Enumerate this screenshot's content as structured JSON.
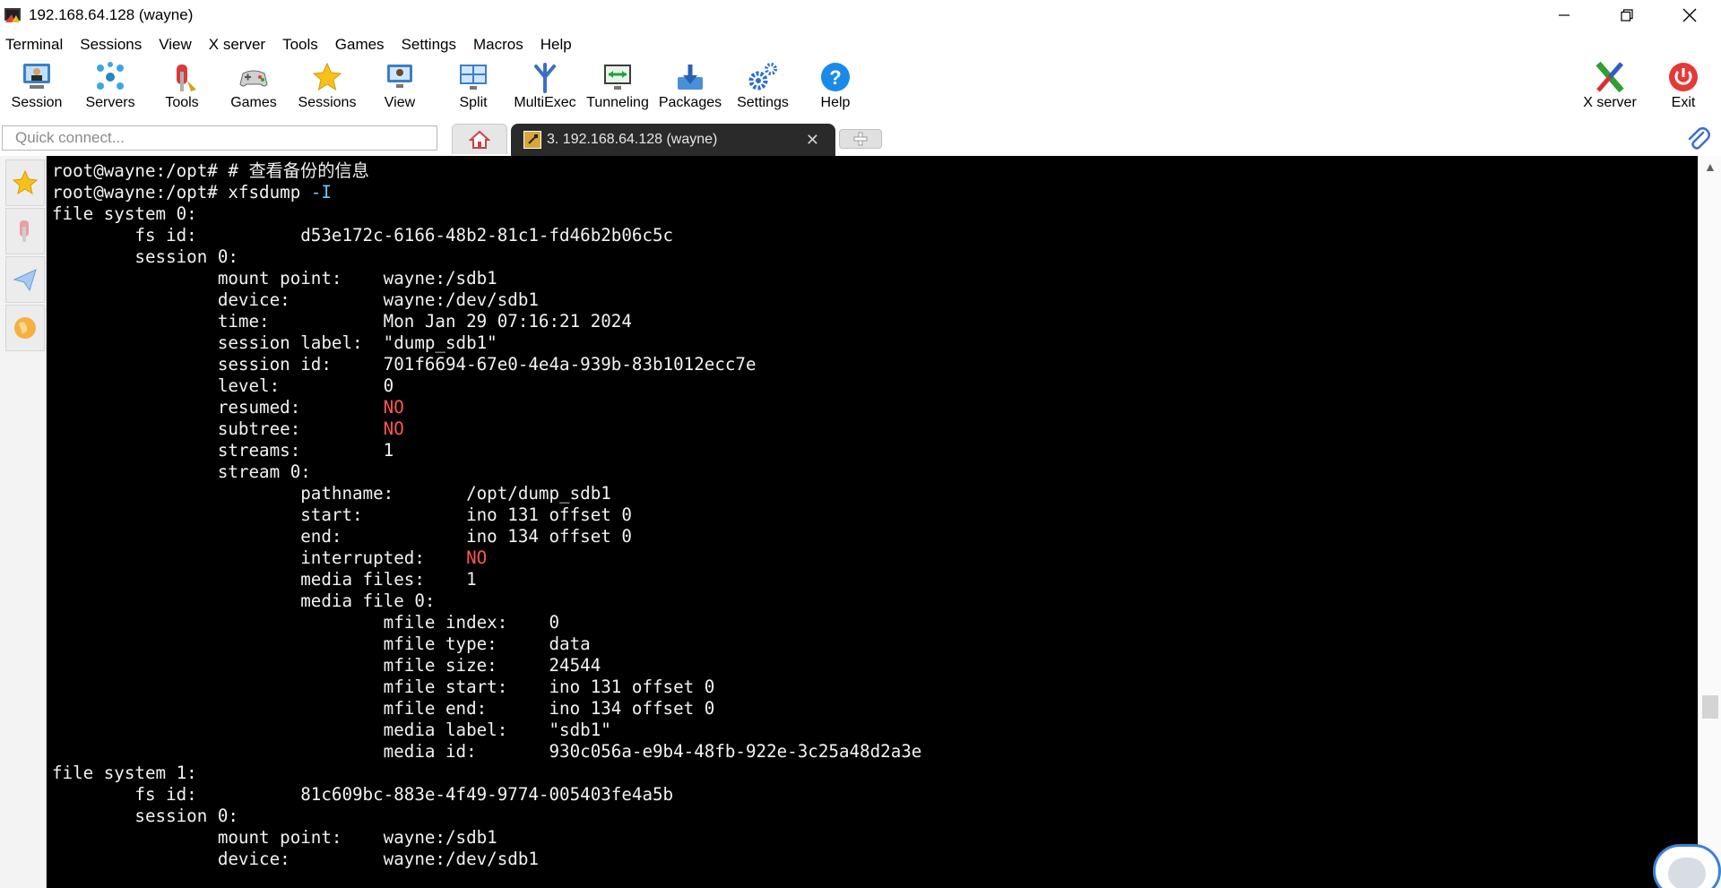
{
  "window": {
    "title": "192.168.64.128 (wayne)"
  },
  "menu": [
    "Terminal",
    "Sessions",
    "View",
    "X server",
    "Tools",
    "Games",
    "Settings",
    "Macros",
    "Help"
  ],
  "toolbar": {
    "session": "Session",
    "servers": "Servers",
    "tools": "Tools",
    "games": "Games",
    "sessions": "Sessions",
    "view": "View",
    "split": "Split",
    "multiexec": "MultiExec",
    "tunneling": "Tunneling",
    "packages": "Packages",
    "settings": "Settings",
    "help": "Help",
    "xserver": "X server",
    "exit": "Exit"
  },
  "tabs": {
    "quick_connect_placeholder": "Quick connect...",
    "session_tab_label": "3. 192.168.64.128 (wayne)",
    "close_glyph": "✕"
  },
  "terminal": {
    "lines": [
      [
        {
          "t": "root@wayne:/opt# # 查看备份的信息",
          "c": ""
        }
      ],
      [
        {
          "t": "root@wayne:/opt# xfsdump ",
          "c": ""
        },
        {
          "t": "-I",
          "c": "cyan"
        }
      ],
      [
        {
          "t": "file system 0:",
          "c": ""
        }
      ],
      [
        {
          "t": "        fs id:          d53e172c-6166-48b2-81c1-fd46b2b06c5c",
          "c": ""
        }
      ],
      [
        {
          "t": "        session 0:",
          "c": ""
        }
      ],
      [
        {
          "t": "                mount point:    wayne:/sdb1",
          "c": ""
        }
      ],
      [
        {
          "t": "                device:         wayne:/dev/sdb1",
          "c": ""
        }
      ],
      [
        {
          "t": "                time:           Mon Jan 29 07:16:21 2024",
          "c": ""
        }
      ],
      [
        {
          "t": "                session label:  \"dump_sdb1\"",
          "c": ""
        }
      ],
      [
        {
          "t": "                session id:     701f6694-67e0-4e4a-939b-83b1012ecc7e",
          "c": ""
        }
      ],
      [
        {
          "t": "                level:          0",
          "c": ""
        }
      ],
      [
        {
          "t": "                resumed:        ",
          "c": ""
        },
        {
          "t": "NO",
          "c": "red"
        }
      ],
      [
        {
          "t": "                subtree:        ",
          "c": ""
        },
        {
          "t": "NO",
          "c": "red"
        }
      ],
      [
        {
          "t": "                streams:        1",
          "c": ""
        }
      ],
      [
        {
          "t": "                stream 0:",
          "c": ""
        }
      ],
      [
        {
          "t": "                        pathname:       /opt/dump_sdb1",
          "c": ""
        }
      ],
      [
        {
          "t": "                        start:          ino 131 offset 0",
          "c": ""
        }
      ],
      [
        {
          "t": "                        end:            ino 134 offset 0",
          "c": ""
        }
      ],
      [
        {
          "t": "                        interrupted:    ",
          "c": ""
        },
        {
          "t": "NO",
          "c": "red"
        }
      ],
      [
        {
          "t": "                        media files:    1",
          "c": ""
        }
      ],
      [
        {
          "t": "                        media file 0:",
          "c": ""
        }
      ],
      [
        {
          "t": "                                mfile index:    0",
          "c": ""
        }
      ],
      [
        {
          "t": "                                mfile type:     data",
          "c": ""
        }
      ],
      [
        {
          "t": "                                mfile size:     24544",
          "c": ""
        }
      ],
      [
        {
          "t": "                                mfile start:    ino 131 offset 0",
          "c": ""
        }
      ],
      [
        {
          "t": "                                mfile end:      ino 134 offset 0",
          "c": ""
        }
      ],
      [
        {
          "t": "                                media label:    \"sdb1\"",
          "c": ""
        }
      ],
      [
        {
          "t": "                                media id:       930c056a-e9b4-48fb-922e-3c25a48d2a3e",
          "c": ""
        }
      ],
      [
        {
          "t": "file system 1:",
          "c": ""
        }
      ],
      [
        {
          "t": "        fs id:          81c609bc-883e-4f49-9774-005403fe4a5b",
          "c": ""
        }
      ],
      [
        {
          "t": "        session 0:",
          "c": ""
        }
      ],
      [
        {
          "t": "                mount point:    wayne:/sdb1",
          "c": ""
        }
      ],
      [
        {
          "t": "                device:         wayne:/dev/sdb1",
          "c": ""
        }
      ]
    ]
  },
  "colors": {
    "terminal_bg": "#000000",
    "terminal_fg": "#f2f2f2",
    "no_red": "#ff5555",
    "flag_cyan": "#66ccff",
    "tab_active": "#2a2a2a"
  }
}
